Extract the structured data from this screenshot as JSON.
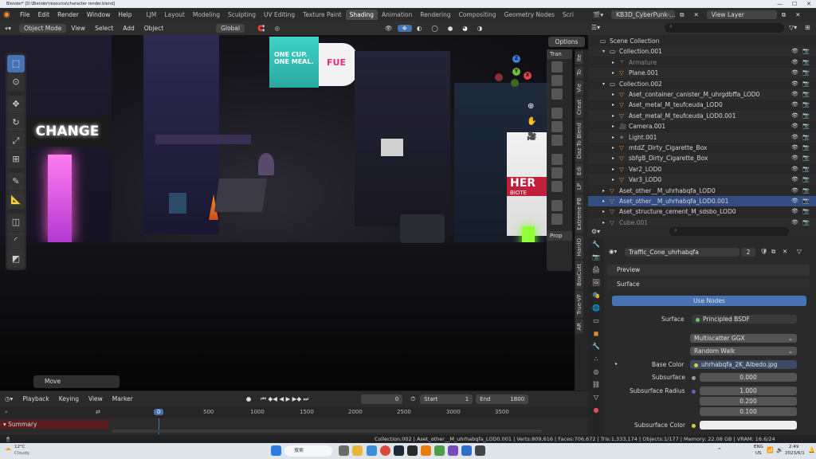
{
  "window": {
    "title": "Blender* [D:\\Blender\\resource\\character render.blend]"
  },
  "menu": [
    "File",
    "Edit",
    "Render",
    "Window",
    "Help"
  ],
  "workspaces": [
    "LJM",
    "Layout",
    "Modeling",
    "Sculpting",
    "UV Editing",
    "Texture Paint",
    "Shading",
    "Animation",
    "Rendering",
    "Compositing",
    "Geometry Nodes",
    "Scri"
  ],
  "active_workspace": "Shading",
  "viewport_header": {
    "mode": "Object Mode",
    "items": [
      "View",
      "Select",
      "Add",
      "Object"
    ],
    "transform": "Global",
    "options": "Options"
  },
  "viewport": {
    "sign_change": "CHANGE",
    "sign_cup": "ONE CUP. ONE MEAL.",
    "sign_hero": "HER",
    "sign_biote": "BIOTE",
    "gizmo": {
      "x": "X",
      "y": "Y",
      "z": "Z"
    },
    "move_panel": "Move",
    "tran_label": "Tran",
    "prop_label": "Prop"
  },
  "side_tabs": [
    "Ite",
    "To",
    "Vie",
    "Creat",
    "Daz To Blend",
    "Edi",
    "LP",
    "Extreme PB",
    "HardO",
    "BoxCutt",
    "True-VF",
    "AR"
  ],
  "timeline": {
    "playback": "Playback",
    "keying": "Keying",
    "view": "View",
    "marker": "Marker",
    "current_frame": "0",
    "start_label": "Start",
    "start": "1",
    "end_label": "End",
    "end": "1800",
    "summary": "Summary",
    "ruler": [
      "0",
      "500",
      "1000",
      "1500",
      "2000",
      "2500",
      "3000",
      "3500"
    ]
  },
  "outliner": {
    "scene": "KB3D_CyberPunk-...",
    "view_layer": "View Layer",
    "rows": [
      {
        "label": "Scene Collection",
        "indent": 0,
        "icon": "scene"
      },
      {
        "label": "Collection.001",
        "indent": 1,
        "icon": "collection"
      },
      {
        "label": "Armature",
        "indent": 2,
        "icon": "armature",
        "dim": true
      },
      {
        "label": "Plane.001",
        "indent": 2,
        "icon": "mesh"
      },
      {
        "label": "Collection.002",
        "indent": 1,
        "icon": "collection"
      },
      {
        "label": "Aset_container_canister_M_uhrgdbffa_LOD0",
        "indent": 2,
        "icon": "mesh"
      },
      {
        "label": "Aset_metal_M_teufceuda_LOD0",
        "indent": 2,
        "icon": "mesh"
      },
      {
        "label": "Aset_metal_M_teufceuda_LOD0.001",
        "indent": 2,
        "icon": "mesh"
      },
      {
        "label": "Camera.001",
        "indent": 2,
        "icon": "camera"
      },
      {
        "label": "Light.001",
        "indent": 2,
        "icon": "light"
      },
      {
        "label": "mtdZ_Dirty_Cigarette_Box",
        "indent": 2,
        "icon": "mesh"
      },
      {
        "label": "sbfgB_Dirty_Cigarette_Box",
        "indent": 2,
        "icon": "mesh"
      },
      {
        "label": "Var2_LOD0",
        "indent": 2,
        "icon": "mesh"
      },
      {
        "label": "Var3_LOD0",
        "indent": 2,
        "icon": "mesh"
      },
      {
        "label": "Aset_other__M_uhrhabqfa_LOD0",
        "indent": 1,
        "icon": "mesh"
      },
      {
        "label": "Aset_other__M_uhrhabqfa_LOD0.001",
        "indent": 1,
        "icon": "mesh",
        "selected": true
      },
      {
        "label": "Aset_structure_cement_M_sdsbo_LOD0",
        "indent": 1,
        "icon": "mesh"
      },
      {
        "label": "Cube.001",
        "indent": 1,
        "icon": "mesh",
        "dim": true
      }
    ]
  },
  "properties": {
    "material_name": "Traffic_Cone_uhrhabqfa",
    "user_count": "2",
    "preview": "Preview",
    "surface_panel": "Surface",
    "use_nodes": "Use Nodes",
    "surface_label": "Surface",
    "surface_value": "Principled BSDF",
    "distribution": "Multiscatter GGX",
    "subsurface_method": "Random Walk",
    "base_color_label": "Base Color",
    "base_color_value": "uhrhabqfa_2K_Albedo.jpg",
    "subsurface_label": "Subsurface",
    "subsurface_value": "0.000",
    "subsurface_radius_label": "Subsurface Radius",
    "subsurface_radius": [
      "1.000",
      "0.200",
      "0.100"
    ],
    "subsurface_color_label": "Subsurface Color"
  },
  "statusbar": {
    "text": "Collection.002 | Aset_other__M_uhrhabqfa_LOD0.001 | Verts:809,616 | Faces:706,672 | Tris:1,333,174 | Objects:1/177 | Memory: 22.08 GB | VRAM: 16.6/24"
  },
  "taskbar": {
    "weather_temp": "12°C",
    "weather_desc": "Cloudy",
    "search": "搜索",
    "lang": "ENG",
    "region": "US",
    "time": "2:49",
    "date": "2023/6/1"
  },
  "colors": {
    "accent": "#4772b3",
    "selection": "#334d80",
    "mesh_icon": "#e08a3c"
  }
}
